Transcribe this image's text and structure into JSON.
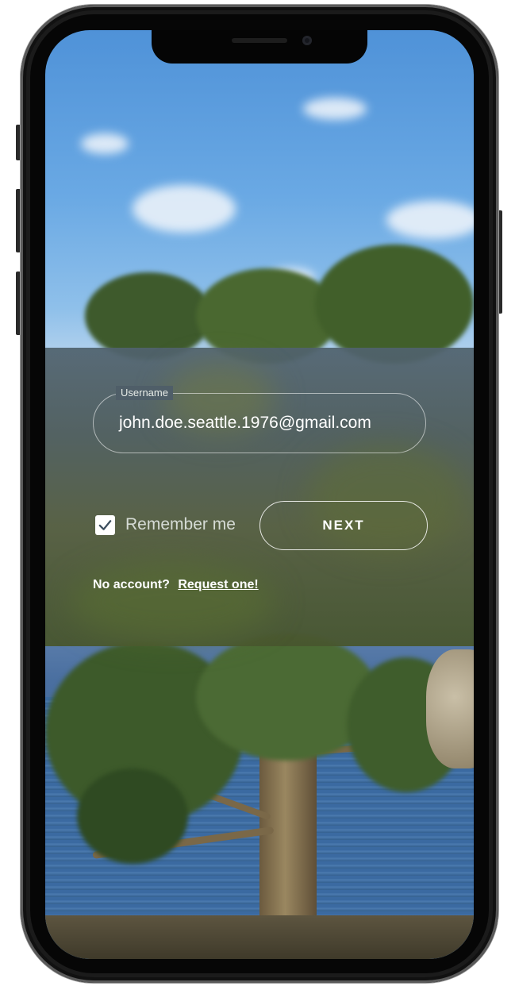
{
  "login": {
    "username_label": "Username",
    "username_value": "john.doe.seattle.1976@gmail.com",
    "remember_label": "Remember me",
    "remember_checked": true,
    "next_label": "NEXT",
    "no_account_text": "No account?",
    "request_link": "Request one!"
  },
  "colors": {
    "sky": "#5a9ee0",
    "panel": "#4f5e68",
    "text": "#ffffff"
  },
  "icons": {
    "checkbox": "checkmark-icon"
  }
}
